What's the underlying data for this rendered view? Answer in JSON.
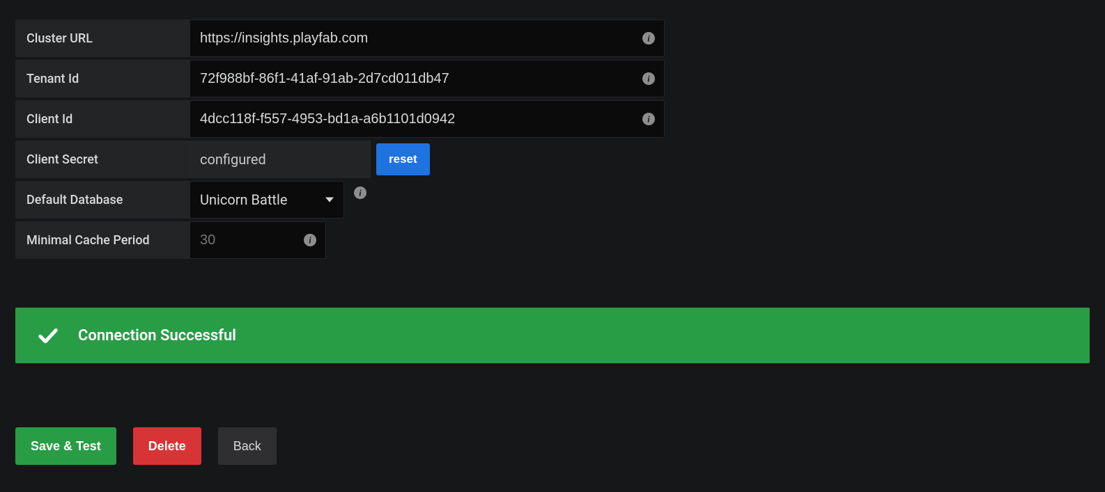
{
  "form": {
    "cluster_url": {
      "label": "Cluster URL",
      "value": "https://insights.playfab.com"
    },
    "tenant_id": {
      "label": "Tenant Id",
      "value": "72f988bf-86f1-41af-91ab-2d7cd011db47"
    },
    "client_id": {
      "label": "Client Id",
      "value": "4dcc118f-f557-4953-bd1a-a6b1101d0942"
    },
    "client_secret": {
      "label": "Client Secret",
      "status": "configured",
      "reset_label": "reset"
    },
    "default_database": {
      "label": "Default Database",
      "selected": "Unicorn Battle"
    },
    "min_cache": {
      "label": "Minimal Cache Period",
      "value": "30"
    }
  },
  "alert": {
    "message": "Connection Successful"
  },
  "buttons": {
    "save_test": "Save & Test",
    "delete": "Delete",
    "back": "Back"
  },
  "colors": {
    "bg": "#161719",
    "panel": "#222426",
    "input_bg": "#0b0b0c",
    "accent_blue": "#1f73e0",
    "accent_green": "#299c46",
    "accent_red": "#d73435"
  }
}
